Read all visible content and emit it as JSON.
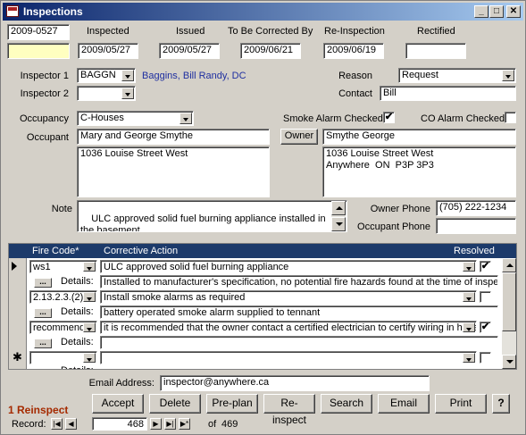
{
  "window": {
    "title": "Inspections"
  },
  "header": {
    "number": "2009-0527",
    "col_inspected": "Inspected",
    "col_issued": "Issued",
    "col_to_be_corrected": "To Be Corrected By",
    "col_reinspection": "Re-Inspection",
    "col_rectified": "Rectified",
    "inspected": "2009/05/27",
    "issued": "2009/05/27",
    "to_be_corrected": "2009/06/21",
    "reinspection": "2009/06/19",
    "rectified": ""
  },
  "inspectors": {
    "inspector1_label": "Inspector 1",
    "inspector1_code": "BAGGN",
    "inspector1_name": "Baggins, Bill Randy, DC",
    "inspector2_label": "Inspector 2",
    "inspector2_code": ""
  },
  "reason": {
    "label": "Reason",
    "value": "Request"
  },
  "contact": {
    "label": "Contact",
    "value": "Bill"
  },
  "occupancy": {
    "label": "Occupancy",
    "value": "C-Houses"
  },
  "alarms": {
    "smoke_label": "Smoke Alarm Checked",
    "smoke_checked": "✔",
    "co_label": "CO Alarm Checked",
    "co_checked": ""
  },
  "occupant": {
    "label": "Occupant",
    "name": "Mary and George Smythe",
    "address": "1036 Louise Street West"
  },
  "owner": {
    "button_label": "Owner",
    "name": "Smythe George",
    "address": "1036 Louise Street West\nAnywhere  ON  P3P 3P3"
  },
  "note": {
    "label": "Note",
    "value": "ULC approved solid fuel burning appliance installed in the basement."
  },
  "phones": {
    "owner_label": "Owner Phone",
    "owner_value": "(705) 222-1234",
    "occupant_label": "Occupant Phone",
    "occupant_value": ""
  },
  "grid": {
    "col_fire_code": "Fire Code*",
    "col_corrective_action": "Corrective Action",
    "col_resolved": "Resolved",
    "details_label": "Details:",
    "new_row_marker": "✱",
    "rows": [
      {
        "code": "ws1",
        "action": "ULC approved solid fuel burning appliance",
        "details": "Installed to manufacturer's specification, no potential fire hazards found at the time of inspection.",
        "resolved": "✔"
      },
      {
        "code": "2.13.2.3.(2)",
        "action": "Install smoke alarms as required",
        "details": "battery operated smoke alarm supplied to tennant",
        "resolved": ""
      },
      {
        "code": "recommenda",
        "action": "it is recommended that the owner contact a certified electrician to certify wiring in house",
        "details": "",
        "resolved": "✔"
      }
    ]
  },
  "email": {
    "label": "Email Address:",
    "value": "inspector@anywhere.ca"
  },
  "status": {
    "text": "1 Reinspect",
    "color": "#a52a00"
  },
  "buttons": {
    "accept": "Accept",
    "delete": "Delete",
    "preplan": "Pre-plan",
    "reinspect": "Re-inspect",
    "search": "Search",
    "email": "Email",
    "print": "Print",
    "help": "?"
  },
  "record_nav": {
    "label": "Record:",
    "current": "468",
    "of_label": "of",
    "total": "469"
  }
}
